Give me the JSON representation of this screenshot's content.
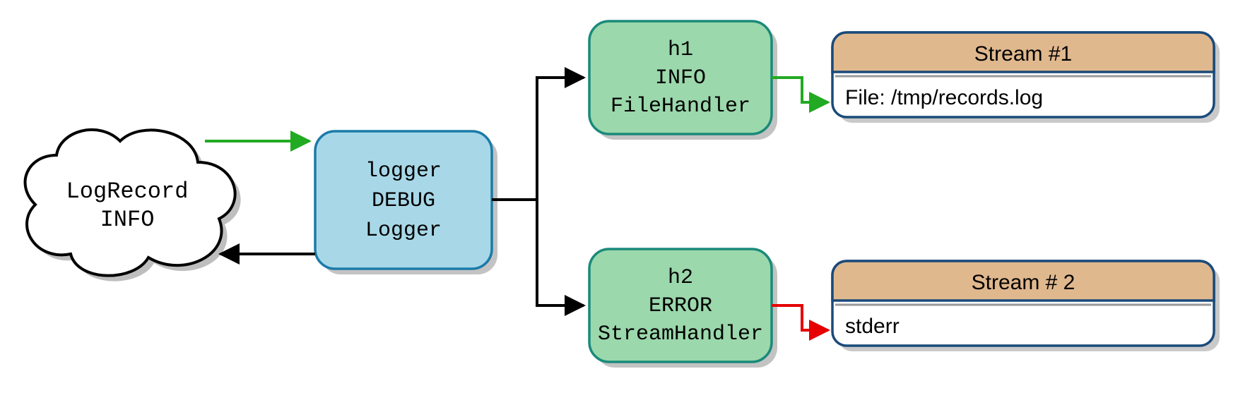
{
  "cloud": {
    "line1": "LogRecord",
    "line2": "INFO"
  },
  "logger": {
    "name": "logger",
    "level": "DEBUG",
    "class": "Logger"
  },
  "handlers": [
    {
      "name": "h1",
      "level": "INFO",
      "class": "FileHandler",
      "stream_title": "Stream #1",
      "stream_content": "File: /tmp/records.log",
      "arrow_color": "#22aa22"
    },
    {
      "name": "h2",
      "level": "ERROR",
      "class": "StreamHandler",
      "stream_title": "Stream # 2",
      "stream_content": "stderr",
      "arrow_color": "#e60000"
    }
  ],
  "colors": {
    "cloud_stroke": "#000000",
    "logger_fill": "#a8d8e8",
    "logger_stroke": "#1a7ba8",
    "handler_fill": "#9bd8ac",
    "handler_stroke": "#1a8a7a",
    "stream_title_fill": "#e0b88e",
    "stream_border": "#1a4a7a",
    "green_arrow": "#22aa22",
    "red_arrow": "#e60000",
    "black_arrow": "#000000",
    "shadow": "#777777"
  }
}
